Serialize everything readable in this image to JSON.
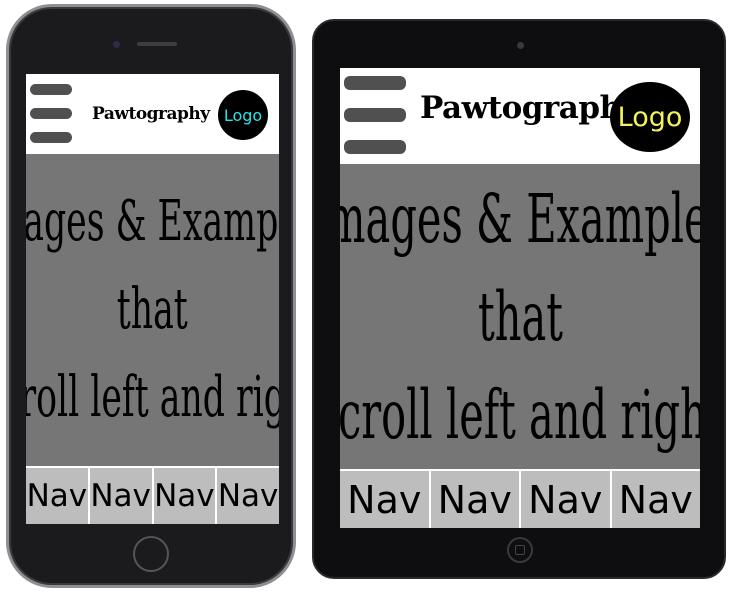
{
  "phone": {
    "brand": "Pawtography",
    "logo": "Logo",
    "logo_text_color": "#22e5ea",
    "hero_lines": [
      "Images & Examples",
      "that",
      "scroll left and right"
    ],
    "nav": [
      "Nav",
      "Nav",
      "Nav",
      "Nav"
    ]
  },
  "tablet": {
    "brand": "Pawtography",
    "logo": "Logo",
    "logo_text_color": "#f2f25a",
    "hero_lines": [
      "Images & Examples",
      "that",
      "scroll left and right"
    ],
    "nav": [
      "Nav",
      "Nav",
      "Nav",
      "Nav"
    ]
  },
  "colors": {
    "hero_background": "#767676",
    "nav_background": "#bdbdbd",
    "menu_bar": "#505050"
  },
  "icons": {
    "menu": "hamburger-menu-icon",
    "home": "home-button-icon"
  }
}
